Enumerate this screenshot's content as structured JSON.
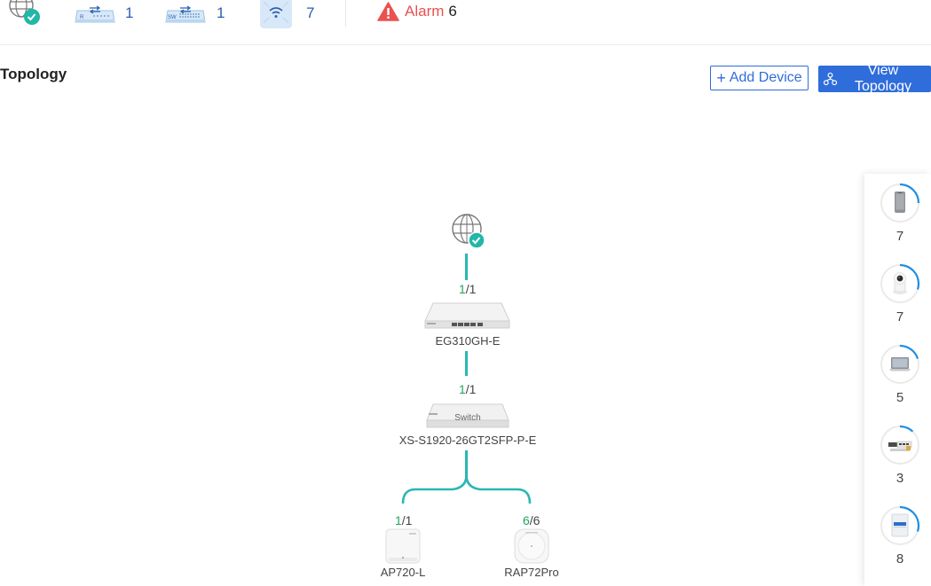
{
  "status_bar": {
    "internet_icon": "globe-check-icon",
    "router": {
      "icon": "router-icon",
      "count": "1"
    },
    "switch": {
      "icon": "switch-icon",
      "count": "1"
    },
    "ap": {
      "icon": "wifi-ap-icon",
      "count": "7"
    },
    "alarm": {
      "icon": "warning-triangle-icon",
      "label": "Alarm",
      "count": "6",
      "color": "#e9524f"
    }
  },
  "page": {
    "title": "Topology",
    "add_device_label": "Add Device",
    "view_topology_label": "View Topology",
    "accent_color": "#2f6ddb"
  },
  "topology": {
    "link_color": "#2ab7b3",
    "internet": {
      "icon": "globe-check-icon"
    },
    "gateway": {
      "name": "EG310GH-E",
      "ports_up": "1",
      "ports_total": "/1"
    },
    "switch": {
      "name": "XS-S1920-26GT2SFP-P-E",
      "ports_up": "1",
      "ports_total": "/1",
      "faceplate": "Switch"
    },
    "access_points": [
      {
        "name": "AP720-L",
        "ports_up": "1",
        "ports_total": "/1"
      },
      {
        "name": "RAP72Pro",
        "ports_up": "6",
        "ports_total": "/6"
      }
    ]
  },
  "clients": [
    {
      "icon": "phone-icon",
      "count": "7",
      "fill": 0.25
    },
    {
      "icon": "camera-icon",
      "count": "7",
      "fill": 0.3
    },
    {
      "icon": "laptop-icon",
      "count": "5",
      "fill": 0.2
    },
    {
      "icon": "network-device-icon",
      "count": "3",
      "fill": 0.12
    },
    {
      "icon": "panel-ap-icon",
      "count": "8",
      "fill": 0.3
    }
  ]
}
